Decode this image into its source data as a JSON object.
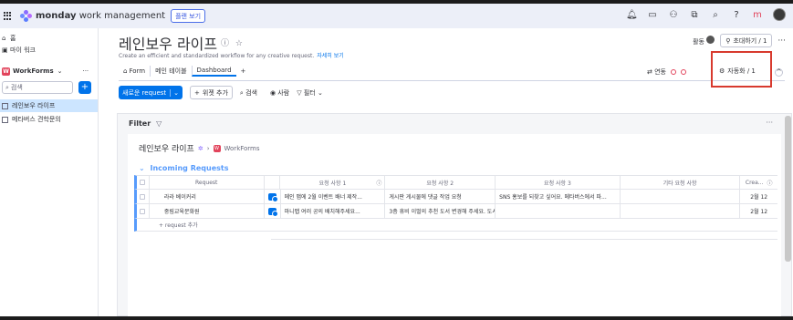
{
  "app": {
    "brand_bold": "monday",
    "brand_rest": " work management",
    "plan_button": "플랜 보기",
    "top_icons": [
      "bell-icon",
      "inbox-icon",
      "invite-icon",
      "apps-icon",
      "search-icon",
      "help-icon",
      "logo-icon"
    ]
  },
  "sidebar": {
    "home": "홈",
    "my_work": "마이 워크",
    "workspace_badge": "W",
    "workspace_name": "WorkForms",
    "workspace_more": "···",
    "search_placeholder": "검색",
    "add_label": "+",
    "boards": [
      {
        "label": "레인보우 라이프",
        "active": true
      },
      {
        "label": "메타버스 견학문의",
        "active": false
      }
    ]
  },
  "header": {
    "title": "레인보우 라이프",
    "description": "Create an efficient and standardized workflow for any creative request.",
    "see_more": "자세히 보기",
    "activity": "활동",
    "invite": "초대하기 / 1",
    "more": "···"
  },
  "tabs": [
    {
      "label": "Form"
    },
    {
      "label": "메인 테이블"
    },
    {
      "label": "Dashboard",
      "active": true
    },
    {
      "label": "+"
    }
  ],
  "right_tools": {
    "integrate": "연동",
    "automation": "자동화 / 1",
    "collapse": "^"
  },
  "toolbar": {
    "new_request": "새로운 request",
    "add_widget": "위젯 추가",
    "search": "검색",
    "person": "사람",
    "filter": "필터"
  },
  "dashboard": {
    "filter_label": "Filter",
    "more": "···",
    "widget_title": "레인보우 라이프",
    "crumb_sep": "›",
    "crumb_badge": "W",
    "crumb_workspace": "WorkForms",
    "group_title": "Incoming Requests",
    "columns": {
      "request": "Request",
      "a1": "요청 사항 1",
      "a2": "요청 사항 2",
      "a3": "요청 사항 3",
      "etc": "기타 요청 사항",
      "date": "Crea..."
    },
    "rows": [
      {
        "request": "라라 베이커리",
        "a1": "메인 맵에 2월 이벤트 배너 제작...",
        "a2": "게시판 게시물에 댓글 작업 요청",
        "a3": "SNS 홍보를 되찾고 싶어요. 메타버스에서 파...",
        "etc": "",
        "date": "2월 12"
      },
      {
        "request": "중림교육문화원",
        "a1": "마니팹 여러 공의 배치해주세요...",
        "a2": "3층 휴비 이벌의 추천 도서 변경해 주세요. 도서 ...",
        "a3": "",
        "etc": "",
        "date": "2월 12"
      }
    ],
    "add_row": "+ request 추가"
  }
}
